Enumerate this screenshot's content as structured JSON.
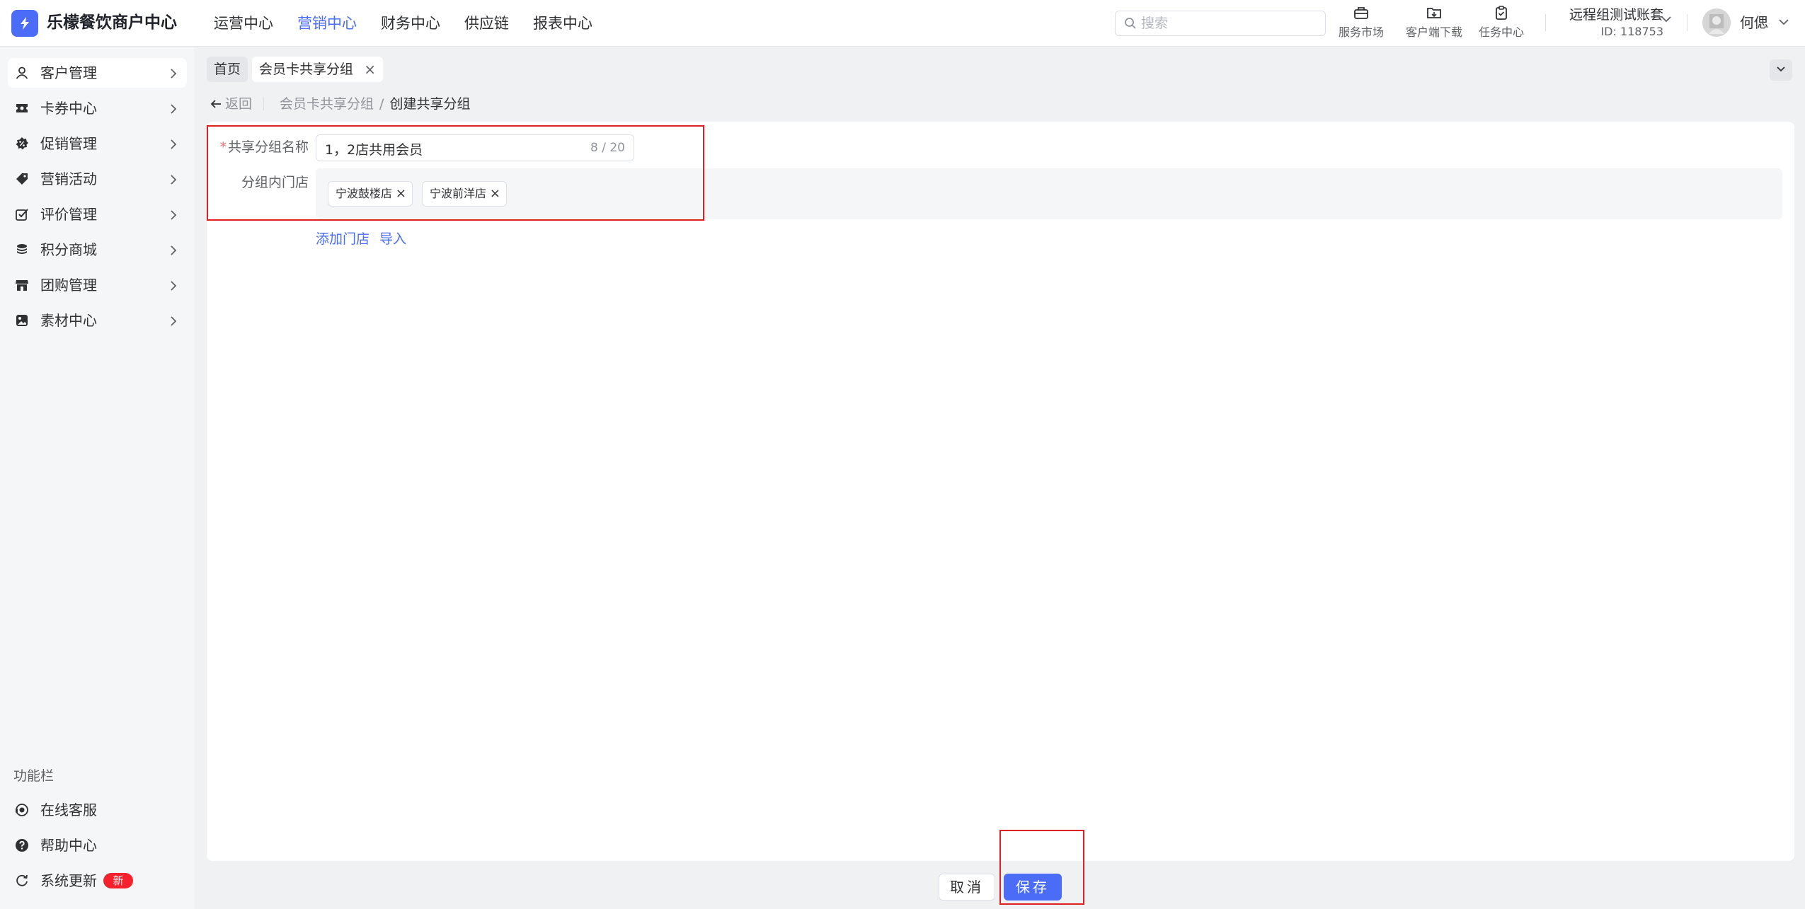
{
  "app": {
    "brand": "乐檬餐饮商户中心",
    "accent": "#4a6cf7"
  },
  "topnav": {
    "items": [
      {
        "label": "运营中心"
      },
      {
        "label": "营销中心",
        "active": true
      },
      {
        "label": "财务中心"
      },
      {
        "label": "供应链"
      },
      {
        "label": "报表中心"
      }
    ]
  },
  "search": {
    "placeholder": "搜索",
    "value": ""
  },
  "tools": {
    "market": "服务市场",
    "download": "客户端下载",
    "tasks": "任务中心"
  },
  "account": {
    "name": "远程组测试账套",
    "id": "ID: 118753",
    "user": "何偲"
  },
  "sidebar": {
    "items": [
      {
        "label": "客户管理",
        "icon": "user-icon"
      },
      {
        "label": "卡券中心",
        "icon": "ticket-icon"
      },
      {
        "label": "促销管理",
        "icon": "discount-icon"
      },
      {
        "label": "营销活动",
        "icon": "tag-icon"
      },
      {
        "label": "评价管理",
        "icon": "review-icon"
      },
      {
        "label": "积分商城",
        "icon": "coins-icon"
      },
      {
        "label": "团购管理",
        "icon": "store-icon"
      },
      {
        "label": "素材中心",
        "icon": "image-icon"
      }
    ],
    "function_title": "功能栏",
    "functions": [
      {
        "label": "在线客服",
        "icon": "headset-icon"
      },
      {
        "label": "帮助中心",
        "icon": "help-icon"
      },
      {
        "label": "系统更新",
        "icon": "refresh-icon",
        "badge": "新"
      }
    ]
  },
  "tabs": {
    "home": "首页",
    "current": "会员卡共享分组",
    "close": "×"
  },
  "breadcrumb": {
    "back": "返回",
    "parent": "会员卡共享分组",
    "separator": "/",
    "current": "创建共享分组"
  },
  "form": {
    "name_label": "共享分组名称",
    "required_mark": "*",
    "name_value": "1，2店共用会员",
    "name_counter": "8 / 20",
    "stores_label": "分组内门店",
    "stores": [
      "宁波鼓楼店",
      "宁波前洋店"
    ],
    "tag_close": "×",
    "add_store": "添加门店",
    "import": "导入"
  },
  "footer": {
    "cancel": "取消",
    "save": "保存"
  }
}
